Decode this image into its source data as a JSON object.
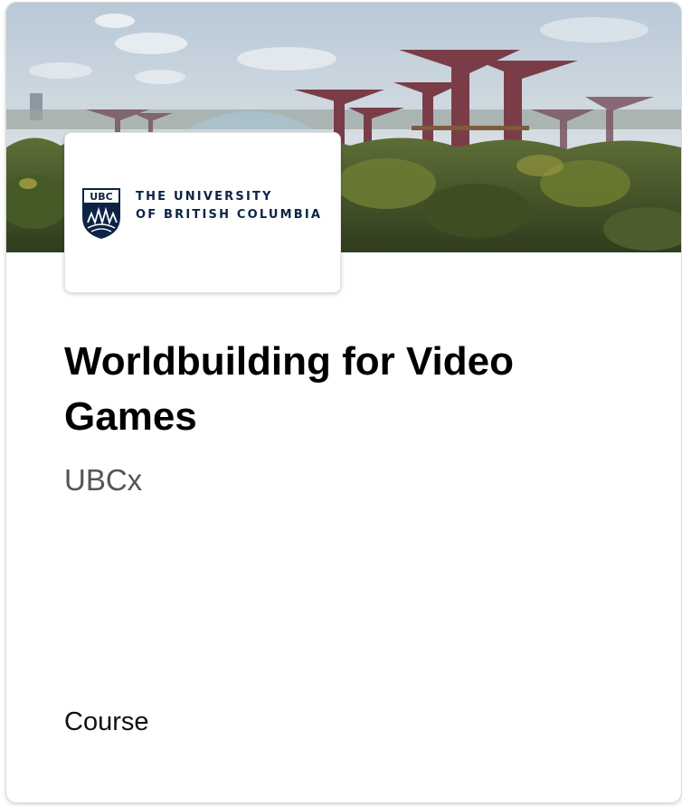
{
  "hero": {
    "image": "gardens-supertree-photo",
    "sky_color": "#c9d5df",
    "foliage_color": "#4a5c2c",
    "supertree_color": "#7a3d48"
  },
  "partner": {
    "logo": "ubc-logo",
    "shield_label": "UBC",
    "name_line1": "THE UNIVERSITY",
    "name_line2": "OF BRITISH COLUMBIA",
    "brand_color": "#0c2346"
  },
  "course": {
    "title": "Worldbuilding for Video Games",
    "org": "UBCx",
    "type": "Course"
  }
}
